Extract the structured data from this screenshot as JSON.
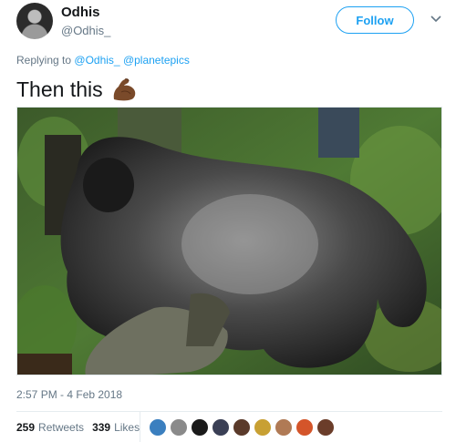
{
  "author": {
    "name": "Odhis",
    "handle": "@Odhis_"
  },
  "follow_label": "Follow",
  "reply": {
    "prefix": "Replying to",
    "mentions": [
      "@Odhis_",
      "@planetepics"
    ]
  },
  "tweet": {
    "text": "Then this",
    "emoji": "flexed-biceps-emoji"
  },
  "photo": {
    "subject": "gorilla-photo"
  },
  "timestamp": "2:57 PM - 4 Feb 2018",
  "stats": {
    "retweets_count": "259",
    "retweets_label": "Retweets",
    "likes_count": "339",
    "likes_label": "Likes"
  },
  "likers": [
    {
      "color": "#3b7fbf"
    },
    {
      "color": "#8a8a8a"
    },
    {
      "color": "#1a1a1a"
    },
    {
      "color": "#3a3f55"
    },
    {
      "color": "#5a3a2a"
    },
    {
      "color": "#c8a033"
    },
    {
      "color": "#b07a55"
    },
    {
      "color": "#d4552a"
    },
    {
      "color": "#6b3d2a"
    }
  ],
  "colors": {
    "accent": "#1da1f2",
    "secondary_text": "#657786"
  }
}
